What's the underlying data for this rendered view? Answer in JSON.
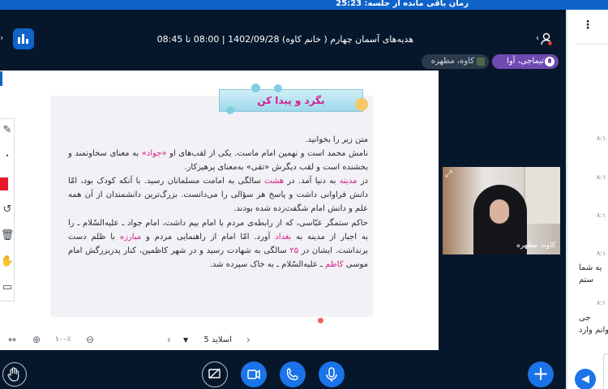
{
  "timer": {
    "text": "زمان باقی مانده از جلسه: 25:23"
  },
  "meeting": {
    "title": "هدیه‌های آسمان چهارم ( خانم کاوه) 1402/09/28 | 08:00 تا 08:45"
  },
  "tags": {
    "talking": "تیماجی، آوا",
    "presenter": "کاوه، مطهره"
  },
  "slide": {
    "heading": "بگرد و پیدا کن",
    "paragraphs": [
      [
        "متن زیر را بخوانید."
      ],
      [
        "نامش محمد است و نهمین امام ماست. یکی از لقب‌های او ",
        {
          "hl": "«جواد»"
        },
        " به معنای سخاوتمند و بخشنده است و لقب دیگرش «تقی» به‌معنای پرهیزکار."
      ],
      [
        "در ",
        {
          "hl": "مدینه"
        },
        " به دنیا آمد. در ",
        {
          "hl": "هشت"
        },
        " سالگی به امامت مسلمانان رسید. با آنکه کودک بود، امّا دانش فراوانی داشت و پاسخ هر سؤالی را می‌دانست. بزرگ‌ترین دانشمندان از آن همه علم و دانش امام شگفت‌زده شده بودند."
      ],
      [
        "حاکم ستمگر عبّاسی، که از رابطه‌ی مردم با امام بیم داشت، امام جواد ـ علیه‌السّلام ـ را به اجبار از مدینه به ",
        {
          "hl": "بغداد"
        },
        " آورد. امّا امام از راهنمایی مردم و ",
        {
          "hl": "مبارزه"
        },
        " با ظلم دست برنداشت. ایشان در ",
        {
          "hl": "۲۵"
        },
        " سالگی به شهادت رسید و در شهر کاظمین، کنار پدربزرگش امام موسی ",
        {
          "hl": "کاظم"
        },
        " ـ علیه‌السّلام ـ به خاک سپرده شد."
      ]
    ]
  },
  "controls": {
    "slide_label": "اسلاید 5",
    "zoom": "۱۰۰٪"
  },
  "webcam": {
    "name": "کاوه، مطهره"
  },
  "chat": {
    "timestamps": [
      "۸:۱",
      "۸:۱",
      "۸:۱",
      "۸:۱",
      "۸:۱"
    ],
    "msg1a": "یه شما",
    "msg1b": "ستم",
    "msg2a": "جی",
    "msg2b": "توانم وارد"
  },
  "colors": {
    "accent": "#1a73e8",
    "highlight": "#d21c8c",
    "bg": "#06172b"
  }
}
